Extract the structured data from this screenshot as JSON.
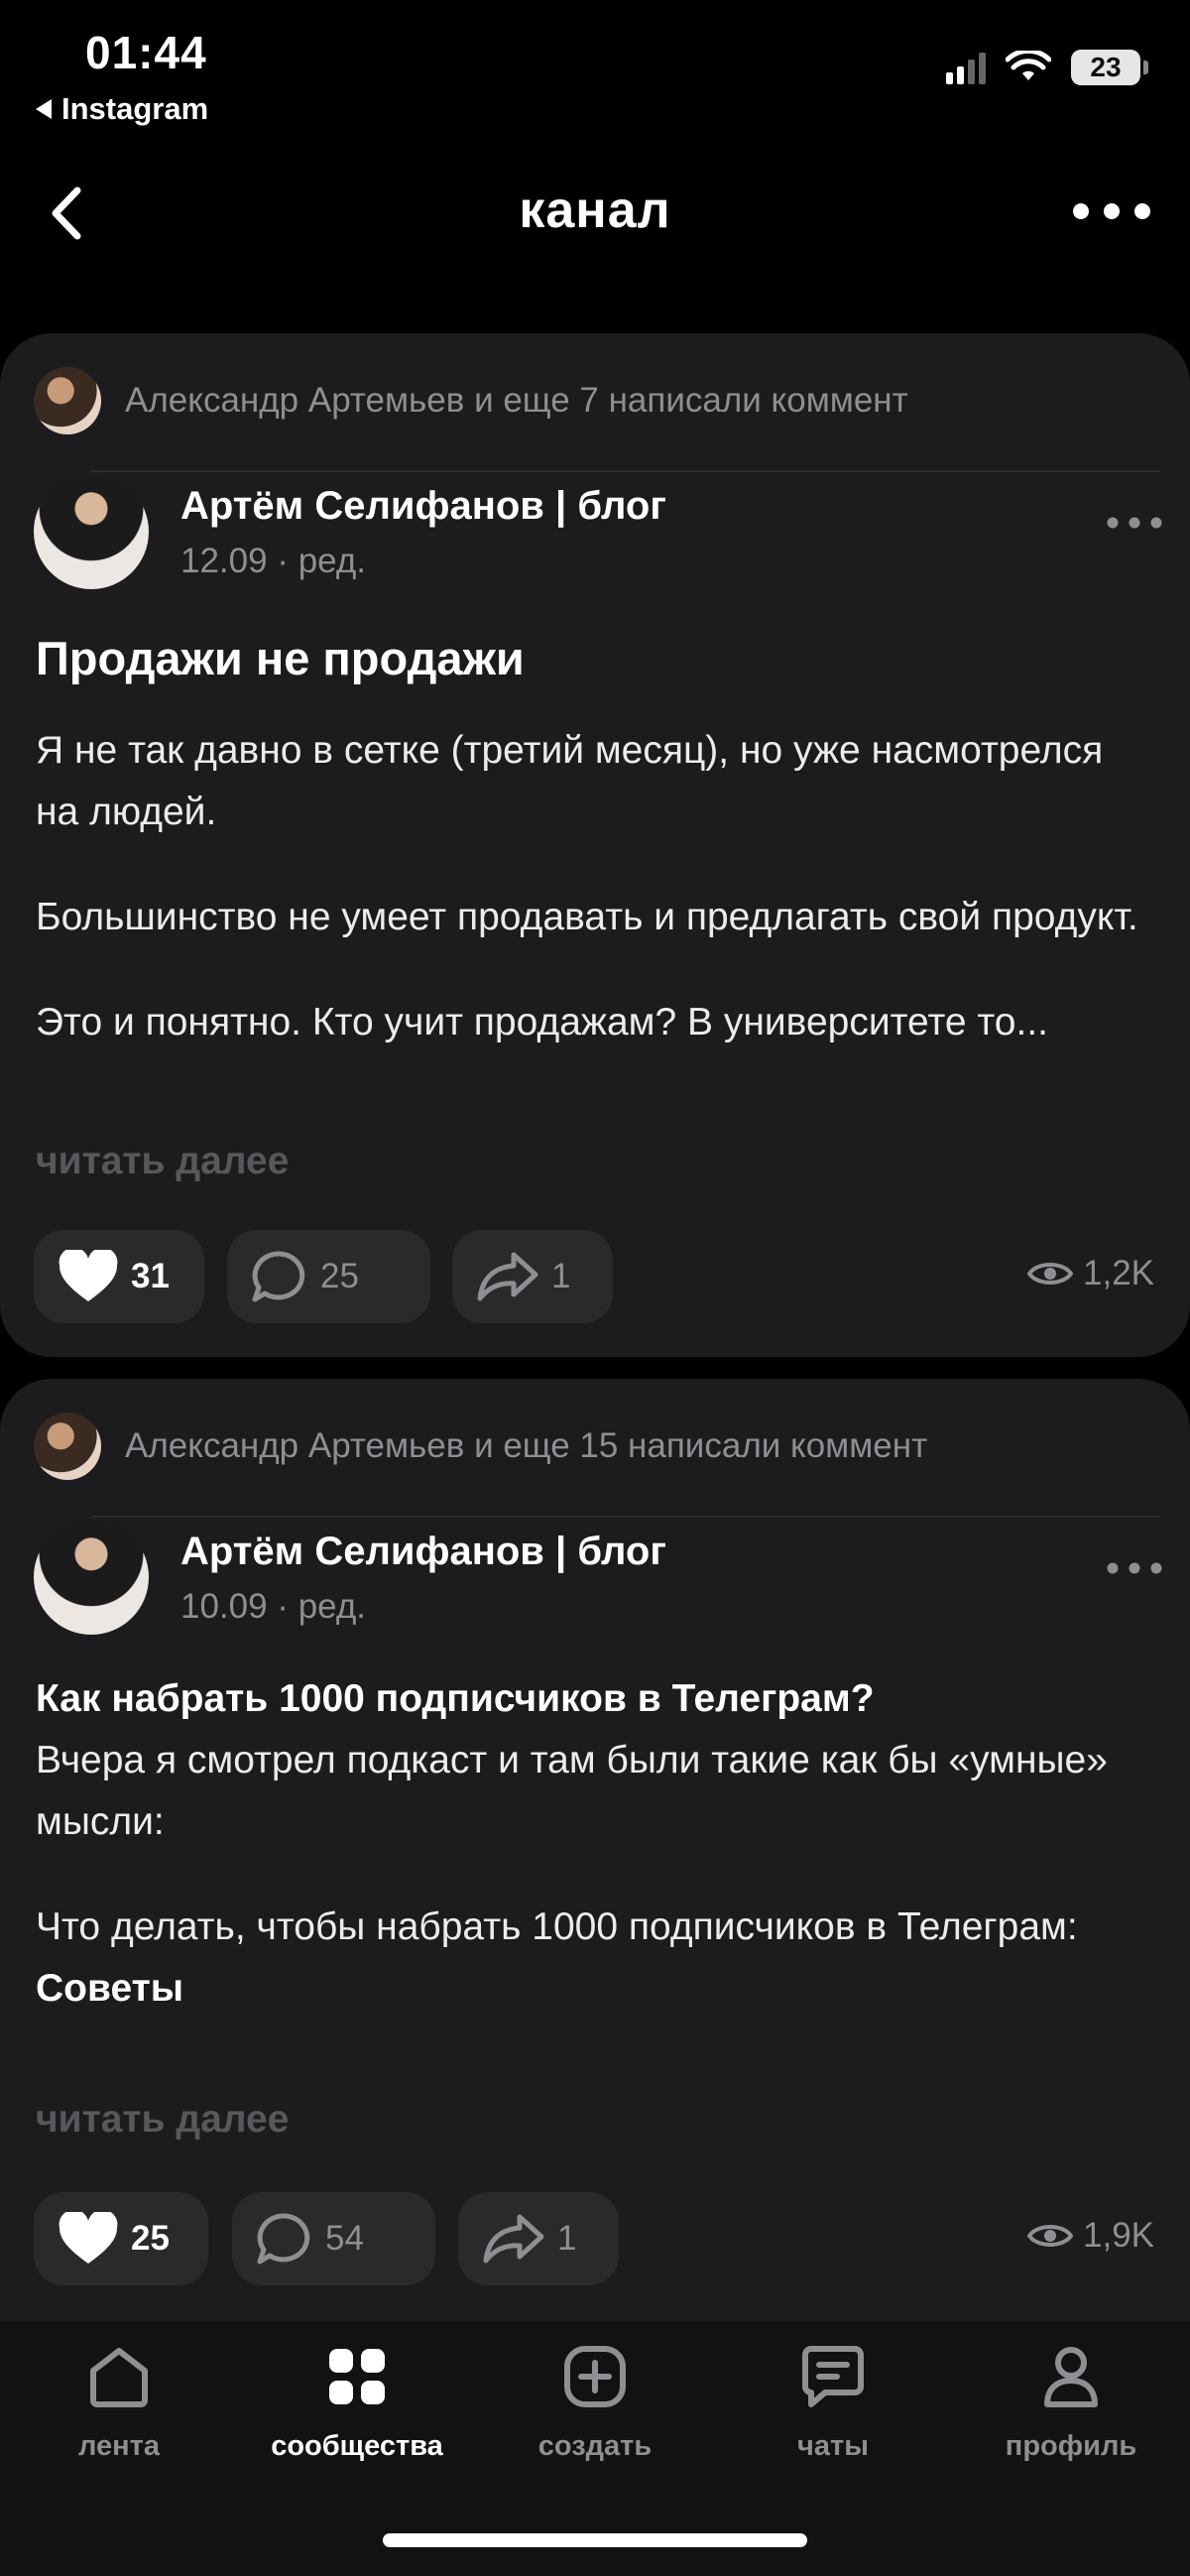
{
  "status_bar": {
    "time": "01:44",
    "back_app": "Instagram",
    "battery": "23",
    "icons": [
      "signal-icon",
      "wifi-icon",
      "battery-icon"
    ]
  },
  "header": {
    "title": "канал",
    "back_icon": "chevron-left-icon",
    "more_icon": "more-horizontal-icon"
  },
  "posts": [
    {
      "activity": "Александр Артемьев и еще 7 написали коммент",
      "author": "Артём Селифанов | блог",
      "date": "12.09 · ред.",
      "title": "Продажи не продажи",
      "paragraphs": [
        "Я не так давно в сетке (третий месяц), но уже насмотрелся на людей.",
        "Большинство не умеет продавать и предлагать свой продукт.",
        "Это и понятно. Кто учит продажам? В университете то..."
      ],
      "read_more": "читать далее",
      "likes": "31",
      "comments": "25",
      "shares": "1",
      "views": "1,2K"
    },
    {
      "activity": "Александр Артемьев и еще 15 написали коммент",
      "author": "Артём Селифанов | блог",
      "date": "10.09 · ред.",
      "bold_line": "Как набрать 1000 подписчиков в Телеграм?",
      "line_2": "Вчера я смотрел подкаст и там были такие как бы «умные» мысли:",
      "line_3": "Что делать, чтобы набрать 1000 подписчиков в Телеграм:",
      "bold_line_2": "Советы",
      "read_more": "читать далее",
      "likes": "25",
      "comments": "54",
      "shares": "1",
      "views": "1,9K"
    }
  ],
  "nav": [
    {
      "label": "лента",
      "icon": "home-icon"
    },
    {
      "label": "сообщества",
      "icon": "grid-icon"
    },
    {
      "label": "создать",
      "icon": "plus-square-icon"
    },
    {
      "label": "чаты",
      "icon": "chat-icon"
    },
    {
      "label": "профиль",
      "icon": "profile-icon"
    }
  ],
  "colors": {
    "background": "#000000",
    "card": "#1c1c1e",
    "pill": "#2a2a2c",
    "muted_text": "#8e8e93"
  }
}
